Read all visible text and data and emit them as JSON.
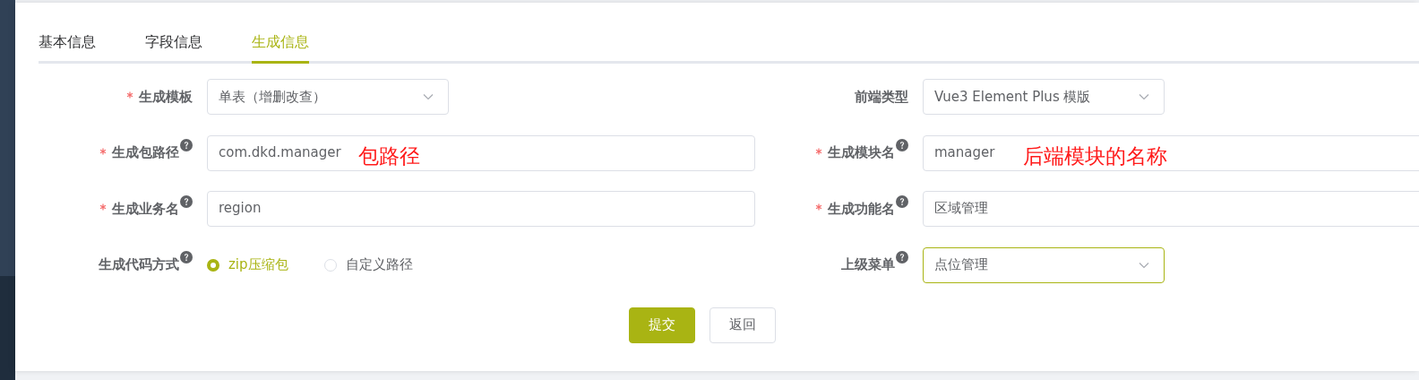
{
  "tabs": [
    {
      "label": "基本信息",
      "selected": false
    },
    {
      "label": "字段信息",
      "selected": false
    },
    {
      "label": "生成信息",
      "selected": true
    }
  ],
  "rows": [
    {
      "left": {
        "label": "生成模板",
        "required": true,
        "help": false,
        "kind": "select",
        "value": "单表（增删改查）",
        "focused": false
      },
      "right": {
        "label": "前端类型",
        "required": false,
        "help": false,
        "kind": "select",
        "value": "Vue3 Element Plus 模版",
        "focused": false
      }
    },
    {
      "left": {
        "label": "生成包路径",
        "required": true,
        "help": true,
        "kind": "input",
        "value": "com.dkd.manager",
        "annotation": "包路径"
      },
      "right": {
        "label": "生成模块名",
        "required": true,
        "help": true,
        "kind": "input",
        "value": "manager",
        "annotation": "后端模块的名称"
      }
    },
    {
      "left": {
        "label": "生成业务名",
        "required": true,
        "help": true,
        "kind": "input",
        "value": "region"
      },
      "right": {
        "label": "生成功能名",
        "required": true,
        "help": true,
        "kind": "input",
        "value": "区域管理"
      }
    },
    {
      "left": {
        "label": "生成代码方式",
        "required": false,
        "help": true,
        "kind": "radio",
        "options": [
          {
            "label": "zip压缩包",
            "selected": true
          },
          {
            "label": "自定义路径",
            "selected": false
          }
        ]
      },
      "right": {
        "label": "上级菜单",
        "required": false,
        "help": true,
        "kind": "select",
        "value": "点位管理",
        "focused": true
      }
    }
  ],
  "buttons": [
    {
      "label": "提交",
      "kind": "primary"
    },
    {
      "label": "返回",
      "kind": "default"
    }
  ]
}
